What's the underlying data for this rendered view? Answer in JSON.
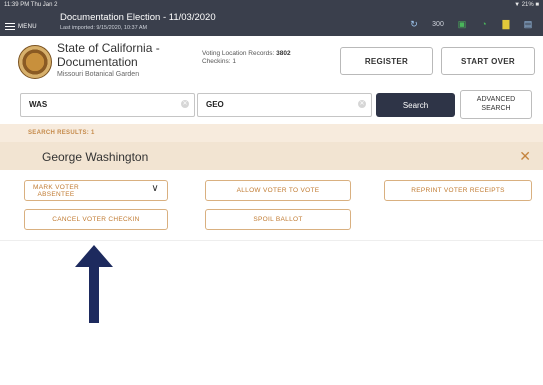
{
  "status": {
    "time": "11:39 PM  Thu Jan 2",
    "battery": "▼ 21% ■"
  },
  "app": {
    "menu_label": "MENU",
    "title": "Documentation Election - 11/03/2020",
    "subtitle": "Last imported: 9/15/2020, 10:37 AM",
    "toolbar": {
      "count": "300"
    }
  },
  "header": {
    "org_line1": "State of California -",
    "org_line2": "Documentation",
    "location": "Missouri Botanical Garden",
    "records_label": "Voting Location Records:",
    "records_value": "3802",
    "checkins_label": "Checkins:",
    "checkins_value": "1",
    "register_label": "REGISTER",
    "start_over_label": "START OVER"
  },
  "search": {
    "last_name": "WAS",
    "first_name": "GEO",
    "search_label": "Search",
    "advanced_line1": "ADVANCED",
    "advanced_line2": "SEARCH"
  },
  "results": {
    "label": "SEARCH RESULTS: 1",
    "voter_name": "George  Washington"
  },
  "actions": {
    "mark_voter_line1": "MARK VOTER",
    "mark_voter_line2": "ABSENTEE",
    "allow_vote": "ALLOW VOTER TO VOTE",
    "reprint": "REPRINT VOTER RECEIPTS",
    "cancel_checkin": "CANCEL VOTER CHECKIN",
    "spoil_ballot": "SPOIL BALLOT"
  },
  "colors": {
    "accent": "#c07a30",
    "topbar": "#3a3f4c",
    "search_button": "#2e3447",
    "arrow": "#1d2a5e"
  },
  "icons": [
    "menu-icon",
    "sync-icon",
    "battery-icon",
    "wifi-icon",
    "signal-icon",
    "printer-icon",
    "close-icon",
    "chevron-down-icon",
    "clear-icon",
    "up-arrow-icon"
  ]
}
